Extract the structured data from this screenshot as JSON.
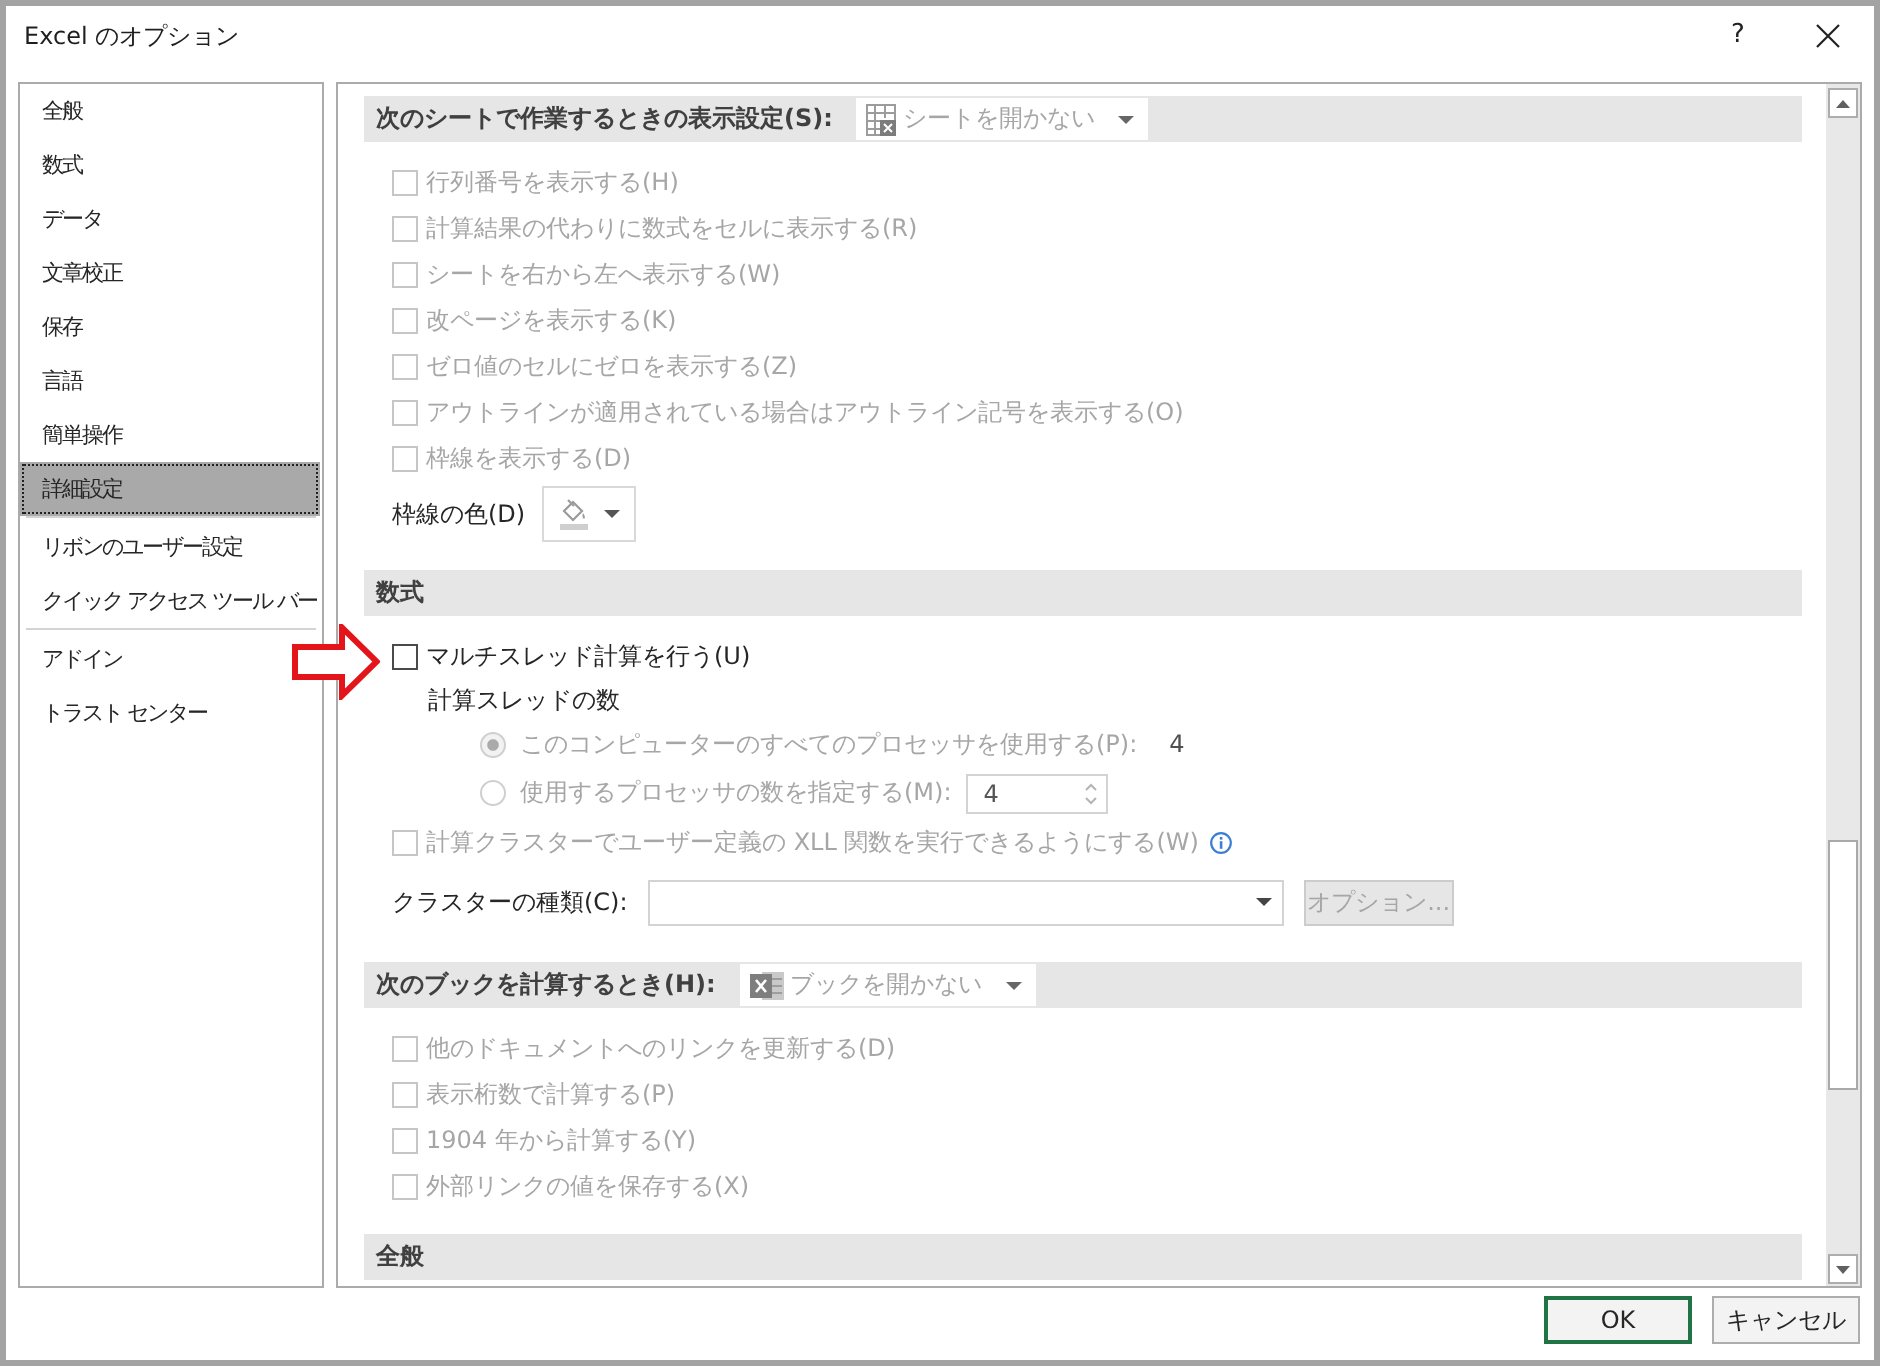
{
  "window": {
    "title": "Excel のオプション",
    "help_button": "?"
  },
  "sidebar": {
    "groups": [
      {
        "items": [
          {
            "label": "全般",
            "selected": false
          },
          {
            "label": "数式",
            "selected": false
          },
          {
            "label": "データ",
            "selected": false
          },
          {
            "label": "文章校正",
            "selected": false
          },
          {
            "label": "保存",
            "selected": false
          },
          {
            "label": "言語",
            "selected": false
          },
          {
            "label": "簡単操作",
            "selected": false
          },
          {
            "label": "詳細設定",
            "selected": true
          }
        ]
      },
      {
        "items": [
          {
            "label": "リボンのユーザー設定",
            "selected": false
          },
          {
            "label": "クイック アクセス ツール バー",
            "selected": false
          }
        ]
      },
      {
        "items": [
          {
            "label": "アドイン",
            "selected": false
          },
          {
            "label": "トラスト センター",
            "selected": false
          }
        ]
      }
    ]
  },
  "sections": [
    {
      "title": "次のシートで作業するときの表示設定(S):",
      "dropdown": {
        "kind": "sheet",
        "value": "シートを開かない",
        "disabled": true
      },
      "rows": [
        {
          "kind": "checkbox",
          "label": "行列番号を表示する(H)",
          "checked": false,
          "disabled": true
        },
        {
          "kind": "checkbox",
          "label": "計算結果の代わりに数式をセルに表示する(R)",
          "checked": false,
          "disabled": true
        },
        {
          "kind": "checkbox",
          "label": "シートを右から左へ表示する(W)",
          "checked": false,
          "disabled": true
        },
        {
          "kind": "checkbox",
          "label": "改ページを表示する(K)",
          "checked": false,
          "disabled": true
        },
        {
          "kind": "checkbox",
          "label": "ゼロ値のセルにゼロを表示する(Z)",
          "checked": false,
          "disabled": true
        },
        {
          "kind": "checkbox",
          "label": "アウトラインが適用されている場合はアウトライン記号を表示する(O)",
          "checked": false,
          "disabled": true
        },
        {
          "kind": "checkbox",
          "label": "枠線を表示する(D)",
          "checked": false,
          "disabled": true
        },
        {
          "kind": "color",
          "label": "枠線の色(D)"
        }
      ]
    },
    {
      "title": "数式",
      "rows": [
        {
          "kind": "checkbox",
          "label": "マルチスレッド計算を行う(U)",
          "checked": false,
          "disabled": false,
          "pointed_at": true
        },
        {
          "kind": "label",
          "label": "計算スレッドの数"
        },
        {
          "kind": "radio",
          "label": "このコンピューターのすべてのプロセッサを使用する(P):",
          "selected": true,
          "disabled": true,
          "reading": "4"
        },
        {
          "kind": "radio",
          "label": "使用するプロセッサの数を指定する(M):",
          "selected": false,
          "disabled": true,
          "spinner": {
            "value": "4"
          }
        },
        {
          "kind": "checkbox",
          "label": "計算クラスターでユーザー定義の XLL 関数を実行できるようにする(W)",
          "checked": false,
          "disabled": true,
          "info": true
        },
        {
          "kind": "combo",
          "label": "クラスターの種類(C):",
          "button": {
            "label": "オプション...",
            "disabled": true
          }
        }
      ]
    },
    {
      "title": "次のブックを計算するとき(H):",
      "dropdown": {
        "kind": "workbook",
        "value": "ブックを開かない",
        "disabled": true
      },
      "rows": [
        {
          "kind": "checkbox",
          "label": "他のドキュメントへのリンクを更新する(D)",
          "checked": false,
          "disabled": true
        },
        {
          "kind": "checkbox",
          "label": "表示桁数で計算する(P)",
          "checked": false,
          "disabled": true
        },
        {
          "kind": "checkbox",
          "label": "1904 年から計算する(Y)",
          "checked": false,
          "disabled": true
        },
        {
          "kind": "checkbox",
          "label": "外部リンクの値を保存する(X)",
          "checked": false,
          "disabled": true
        }
      ]
    },
    {
      "title": "全般"
    }
  ],
  "buttons": [
    {
      "label": "OK",
      "default": true
    },
    {
      "label": "キャンセル",
      "default": false
    }
  ]
}
